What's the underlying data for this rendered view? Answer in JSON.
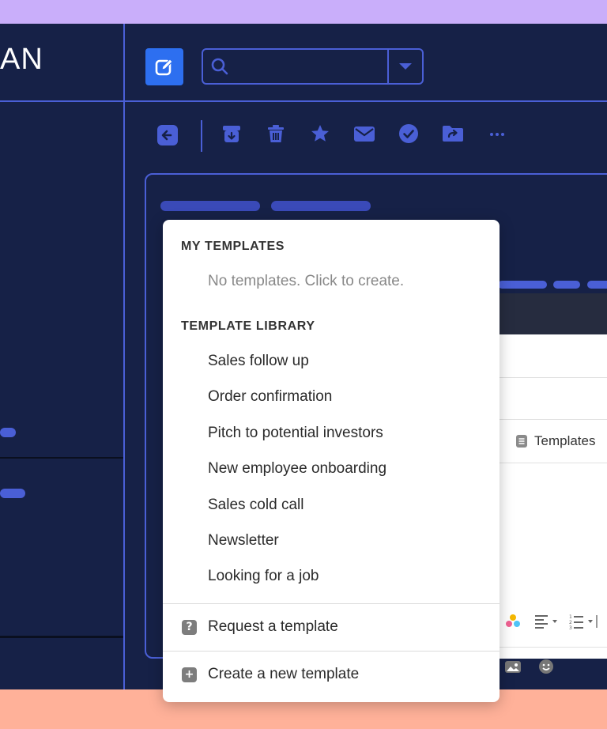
{
  "app": {
    "logo_text": "AN"
  },
  "search": {
    "placeholder": ""
  },
  "templates_button": {
    "label": "Templates"
  },
  "dropdown": {
    "my_templates": {
      "title": "MY TEMPLATES",
      "empty_message": "No templates. Click to create."
    },
    "library": {
      "title": "TEMPLATE LIBRARY",
      "items": [
        "Sales follow up",
        "Order confirmation",
        "Pitch to potential investors",
        "New employee onboarding",
        "Sales cold call",
        "Newsletter",
        "Looking for a job"
      ]
    },
    "actions": {
      "request": "Request a template",
      "create": "Create a new template"
    }
  },
  "icons": {
    "compose": "compose-icon",
    "search": "search-icon",
    "back": "back-arrow-icon",
    "archive": "archive-icon",
    "trash": "trash-icon",
    "star": "star-icon",
    "mail": "mail-icon",
    "check": "check-circle-icon",
    "move": "move-folder-icon",
    "more": "more-icon"
  },
  "colors": {
    "accent": "#2d6ff0",
    "app_background": "#162147",
    "outline": "#4a5fd6",
    "top_band": "#c9aefa",
    "bottom_band": "#ffb199"
  }
}
